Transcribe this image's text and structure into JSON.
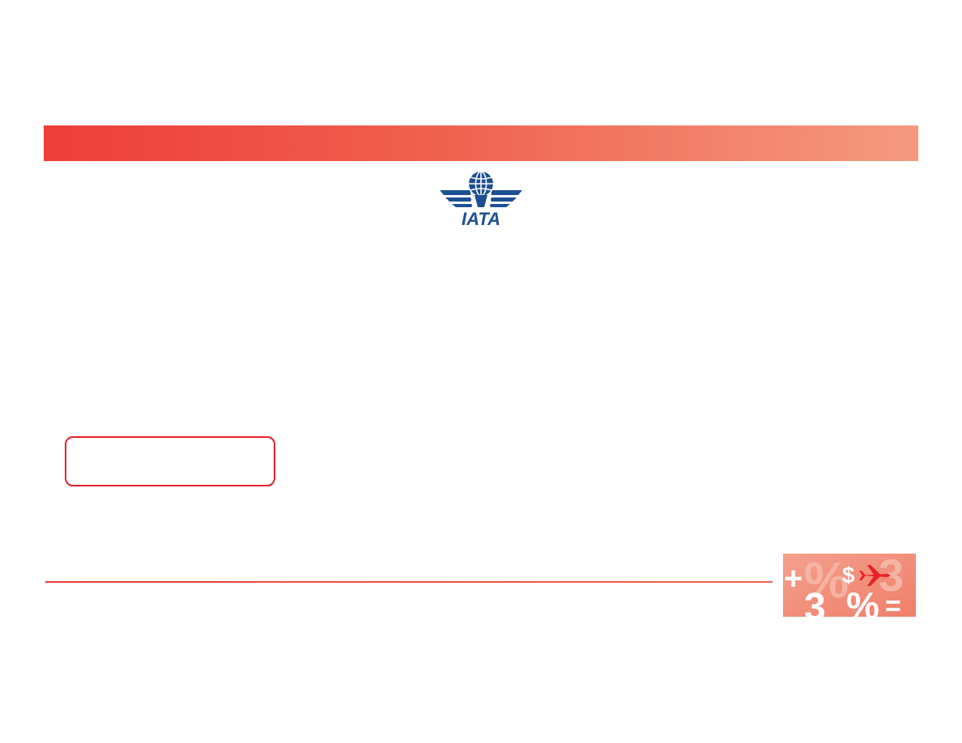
{
  "slide": {
    "logo": {
      "icon": "iata-globe-wings-icon",
      "wordmark": "IATA",
      "color": "#1d4f91"
    },
    "title_band": {
      "gradient_start": "#ee3d3a",
      "gradient_end": "#f59a80"
    },
    "callout": {
      "border_color": "#e8202a"
    },
    "footer": {
      "rule_color": "#ee3d3a",
      "badge": {
        "icon": "finance-symbols-plane-icon",
        "background": "#f08a78",
        "plane_color": "#e8202a"
      }
    }
  }
}
